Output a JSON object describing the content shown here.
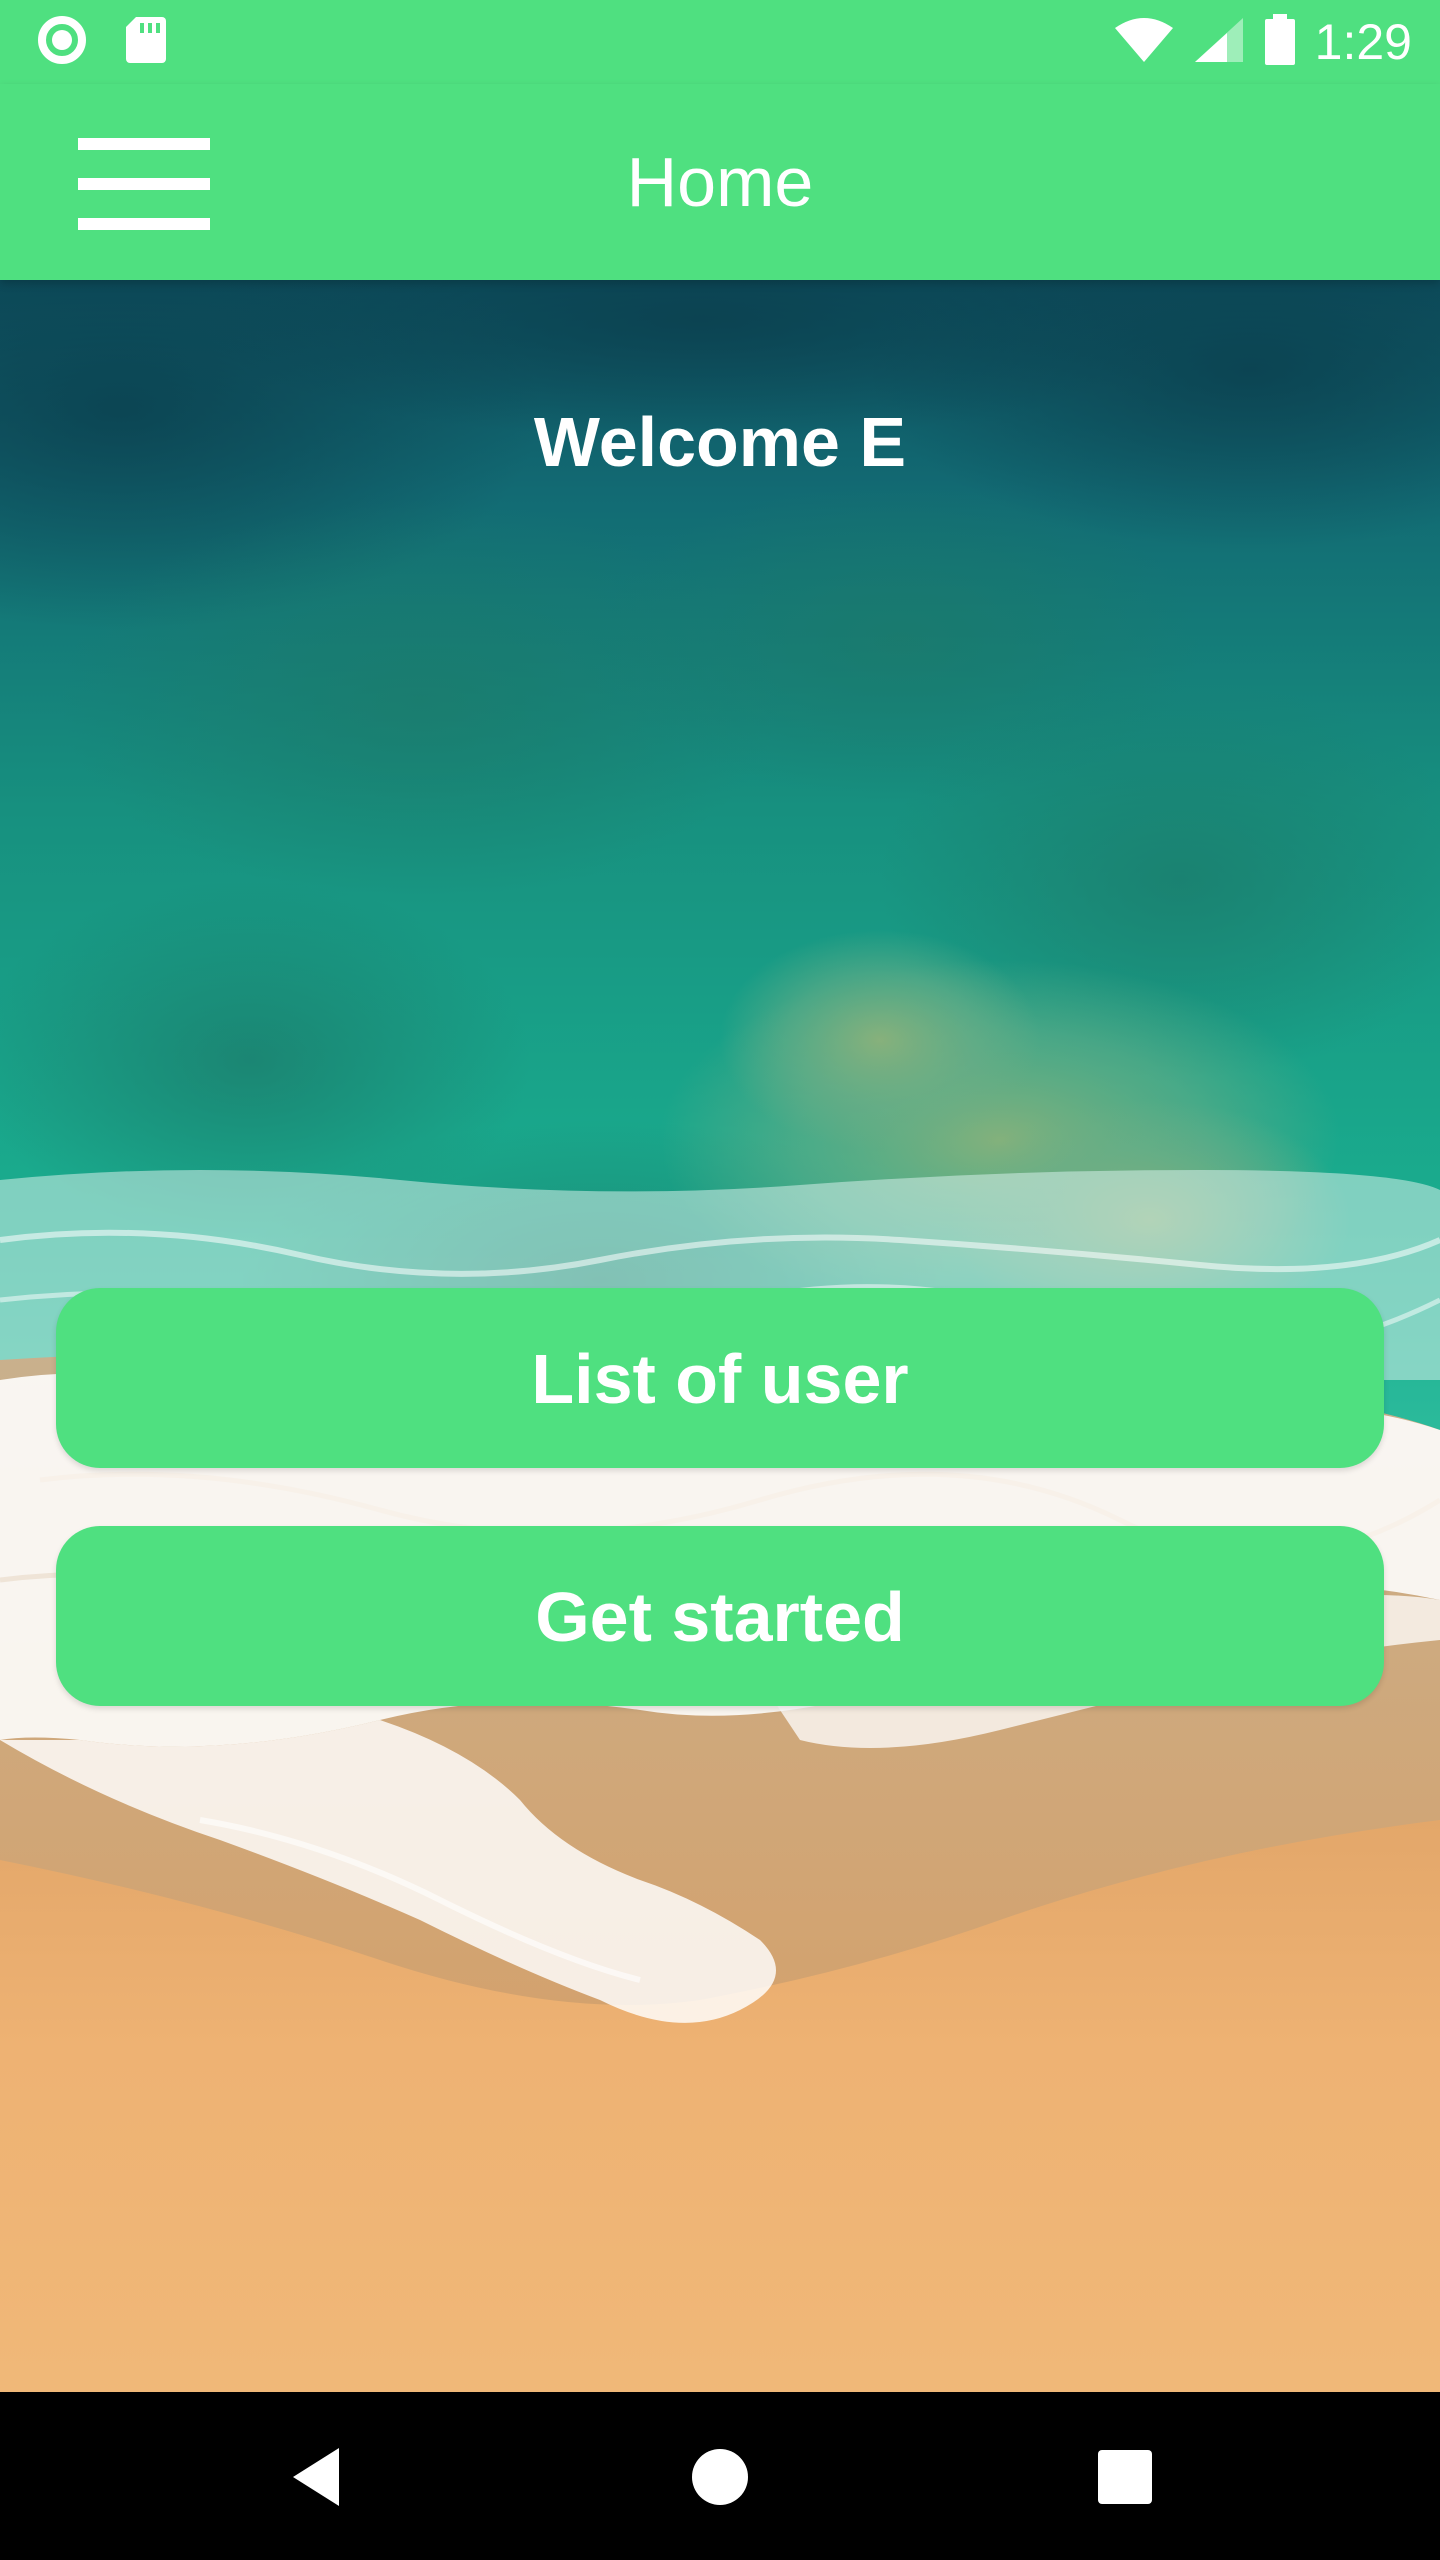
{
  "status_bar": {
    "time": "1:29",
    "icons": [
      "circle-status-icon",
      "sd-card-icon",
      "wifi-icon",
      "cell-signal-icon",
      "battery-icon"
    ]
  },
  "app_bar": {
    "title": "Home",
    "menu_icon": "hamburger-menu-icon"
  },
  "main": {
    "welcome_text": "Welcome E",
    "buttons": [
      {
        "label": "List of user"
      },
      {
        "label": "Get started"
      }
    ]
  },
  "nav_bar": {
    "icons": [
      "back-icon",
      "home-icon",
      "recent-apps-icon"
    ]
  },
  "colors": {
    "accent": "#4fe080",
    "text_on_accent": "#ffffff",
    "nav_background": "#000000"
  }
}
